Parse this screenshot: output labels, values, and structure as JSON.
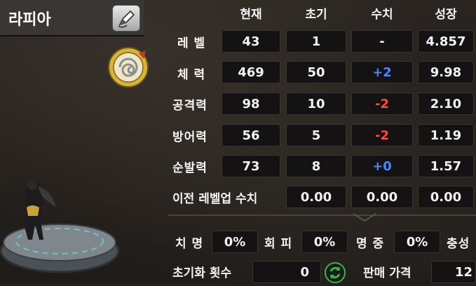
{
  "character": {
    "name": "라피아"
  },
  "table": {
    "headers": [
      "현재",
      "초기",
      "수치",
      "성장"
    ],
    "rows": [
      {
        "label": "레 벨",
        "current": "43",
        "initial": "1",
        "delta": "-",
        "growth": "4.857",
        "delta_color": "neutral"
      },
      {
        "label": "체 력",
        "current": "469",
        "initial": "50",
        "delta": "+2",
        "growth": "9.98",
        "delta_color": "blue"
      },
      {
        "label": "공격력",
        "current": "98",
        "initial": "10",
        "delta": "-2",
        "growth": "2.10",
        "delta_color": "red"
      },
      {
        "label": "방어력",
        "current": "56",
        "initial": "5",
        "delta": "-2",
        "growth": "1.19",
        "delta_color": "red"
      },
      {
        "label": "순발력",
        "current": "73",
        "initial": "8",
        "delta": "+0",
        "growth": "1.57",
        "delta_color": "blue"
      }
    ],
    "prev_levelup": {
      "label": "이전 레벨업 수치",
      "values": [
        "0.00",
        "0.00",
        "0.00"
      ]
    }
  },
  "extra": {
    "crit_label": "치 명",
    "crit_value": "0%",
    "evade_label": "회 피",
    "evade_value": "0%",
    "accuracy_label": "명 중",
    "accuracy_value": "0%",
    "loyalty_label": "충성",
    "reset_label": "초기화 횟수",
    "reset_value": "0",
    "sell_label": "판매 가격",
    "sell_value": "12"
  },
  "colors": {
    "blue": "#4f86ff",
    "red": "#ff4a3d",
    "reset_icon": "#39b44a"
  },
  "icons": {
    "edit": "pen-icon",
    "element_dial": "element-dial-icon",
    "reset": "refresh-icon"
  }
}
